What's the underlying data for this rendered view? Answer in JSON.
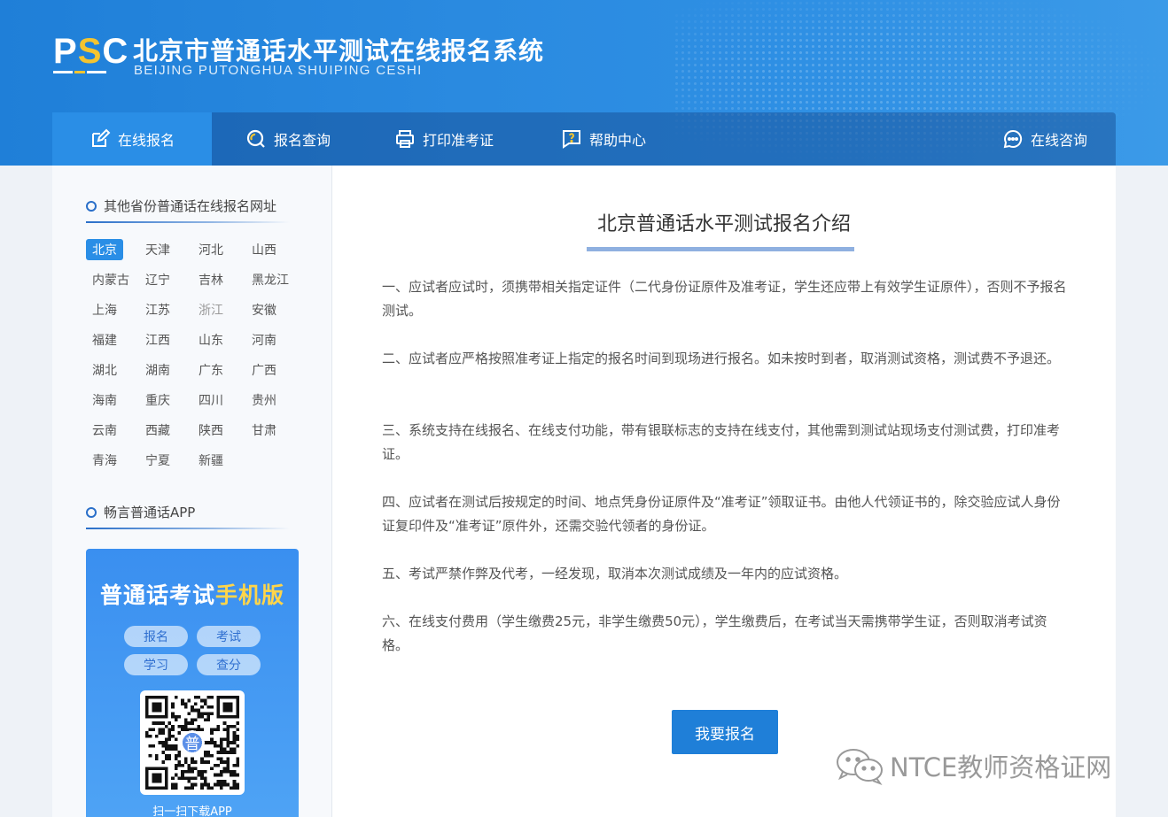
{
  "header": {
    "logo": "PSC",
    "title": "北京市普通话水平测试在线报名系统",
    "subtitle": "BEIJING PUTONGHUA SHUIPING CESHI"
  },
  "nav": {
    "items": [
      {
        "label": "在线报名",
        "icon": "edit-icon"
      },
      {
        "label": "报名查询",
        "icon": "search-icon"
      },
      {
        "label": "打印准考证",
        "icon": "printer-icon"
      },
      {
        "label": "帮助中心",
        "icon": "help-icon"
      }
    ],
    "consult": {
      "label": "在线咨询",
      "icon": "chat-icon"
    }
  },
  "sidebar": {
    "provinces_title": "其他省份普通话在线报名网址",
    "provinces": [
      "北京",
      "天津",
      "河北",
      "山西",
      "内蒙古",
      "辽宁",
      "吉林",
      "黑龙江",
      "上海",
      "江苏",
      "浙江",
      "安徽",
      "福建",
      "江西",
      "山东",
      "河南",
      "湖北",
      "湖南",
      "广东",
      "广西",
      "海南",
      "重庆",
      "四川",
      "贵州",
      "云南",
      "西藏",
      "陕西",
      "甘肃",
      "青海",
      "宁夏",
      "新疆"
    ],
    "active_province": "北京",
    "app_title": "畅言普通话APP",
    "app_card": {
      "title_part1": "普通话考试",
      "title_part2": "手机版",
      "tags": [
        "报名",
        "考试",
        "学习",
        "查分"
      ],
      "qr_center": "普",
      "caption": "扫一扫下载APP"
    }
  },
  "main": {
    "title": "北京普通话水平测试报名介绍",
    "paragraphs": [
      "一、应试者应试时，须携带相关指定证件（二代身份证原件及准考证，学生还应带上有效学生证原件），否则不予报名测试。",
      "二、应试者应严格按照准考证上指定的报名时间到现场进行报名。如未按时到者，取消测试资格，测试费不予退还。",
      "三、系统支持在线报名、在线支付功能，带有银联标志的支持在线支付，其他需到测试站现场支付测试费，打印准考证。",
      "四、应试者在测试后按规定的时间、地点凭身份证原件及“准考证”领取证书。由他人代领证书的，除交验应试人身份证复印件及“准考证”原件外，还需交验代领者的身份证。",
      "五、考试严禁作弊及代考，一经发现，取消本次测试成绩及一年内的应试资格。",
      "六、在线支付费用（学生缴费25元，非学生缴费50元），学生缴费后，在考试当天需携带学生证，否则取消考试资格。"
    ],
    "register_button": "我要报名"
  },
  "watermark": "NTCE教师资格证网",
  "colors": {
    "primary": "#1f7fd8",
    "nav_active": "#2a8ee6",
    "accent_yellow": "#f4c430"
  }
}
